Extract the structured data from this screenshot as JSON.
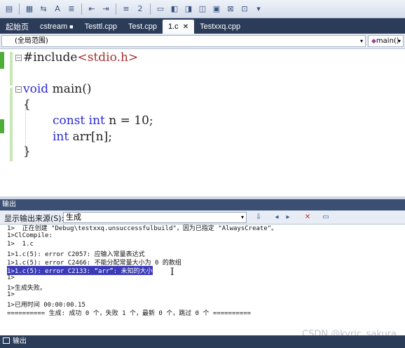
{
  "toolbar": {
    "icons": [
      "comment-icon",
      "uncomment-icon",
      "toggle-icon",
      "format-icon",
      "indent-icon",
      "outdent-icon",
      "list-icon",
      "number-icon",
      "window-icon",
      "bookmark-icon",
      "bookmark-prev-icon",
      "bookmark-next-icon",
      "bookmark-clear-icon",
      "bookmark-folder-icon",
      "bookmark-list-icon"
    ]
  },
  "tabs": [
    {
      "label": "起始页",
      "active": false
    },
    {
      "label": "cstream",
      "active": false,
      "pinned": true
    },
    {
      "label": "Testtl.cpp",
      "active": false
    },
    {
      "label": "Test.cpp",
      "active": false
    },
    {
      "label": "1.c",
      "active": true,
      "close": "✕"
    },
    {
      "label": "Testxxq.cpp",
      "active": false
    }
  ],
  "scope": {
    "left": "(全局范围)",
    "right": "main()"
  },
  "code": {
    "line1_pre": "#include",
    "line1_str": "<stdio.h>",
    "line3_kw": "void",
    "line3_rest": " main()",
    "line4": "{",
    "line5_kw": "const int",
    "line5_rest": " n = 10;",
    "line6_kw": "int",
    "line6_rest": " arr[n];",
    "line7": "}"
  },
  "output": {
    "title": "输出",
    "show_label": "显示输出来源(S):",
    "source": "生成",
    "lines": [
      "1>  正在创建 \"Debug\\testxxq.unsuccessfulbuild\"，因为已指定 \"AlwaysCreate\"。",
      "1>ClCompile:",
      "1>  1.c",
      "1>1.c(5): error C2057: 应输入常量表达式",
      "1>1.c(5): error C2466: 不能分配常量大小为 0 的数组",
      "1>1.c(5): error C2133: “arr”: 未知的大小",
      "1>",
      "1>生成失败。",
      "1>",
      "1>已用时间 00:00:00.15",
      "========== 生成: 成功 0 个，失败 1 个，最新 0 个，跳过 0 个 =========="
    ]
  },
  "watermark": "CSDN @kyric_sakura",
  "statusbar": {
    "label": "输出"
  }
}
